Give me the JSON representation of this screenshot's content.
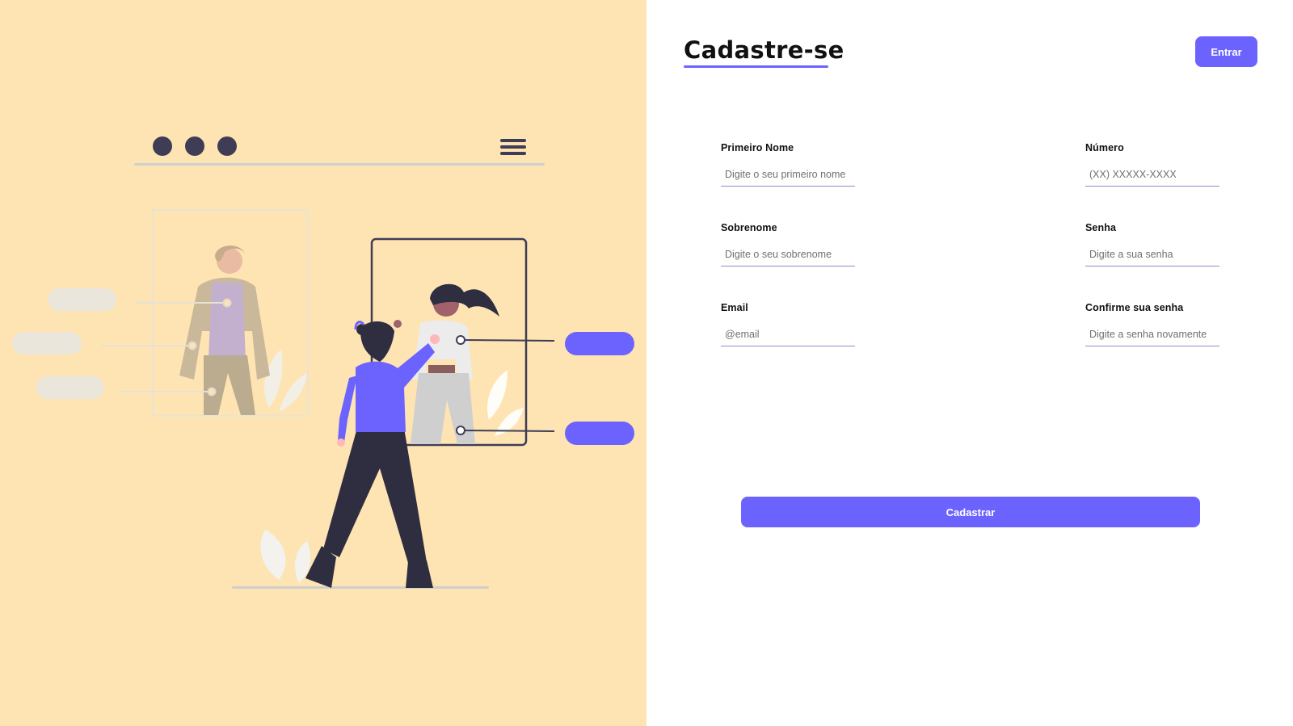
{
  "header": {
    "title": "Cadastre-se",
    "login_label": "Entrar"
  },
  "form": {
    "first_name": {
      "label": "Primeiro Nome",
      "placeholder": "Digite o seu primeiro nome"
    },
    "last_name": {
      "label": "Sobrenome",
      "placeholder": "Digite o seu sobrenome"
    },
    "email": {
      "label": "Email",
      "placeholder": "@email"
    },
    "phone": {
      "label": "Número",
      "placeholder": "(XX) XXXXX-XXXX"
    },
    "password": {
      "label": "Senha",
      "placeholder": "Digite a sua senha"
    },
    "confirm_password": {
      "label": "Confirme sua senha",
      "placeholder": "Digite a senha novamente"
    },
    "submit_label": "Cadastrar"
  },
  "colors": {
    "accent": "#6c63ff",
    "left_background": "#fde4b2",
    "right_background": "#ffffff"
  },
  "illustration": {
    "icon": "sign-up-illustration"
  }
}
